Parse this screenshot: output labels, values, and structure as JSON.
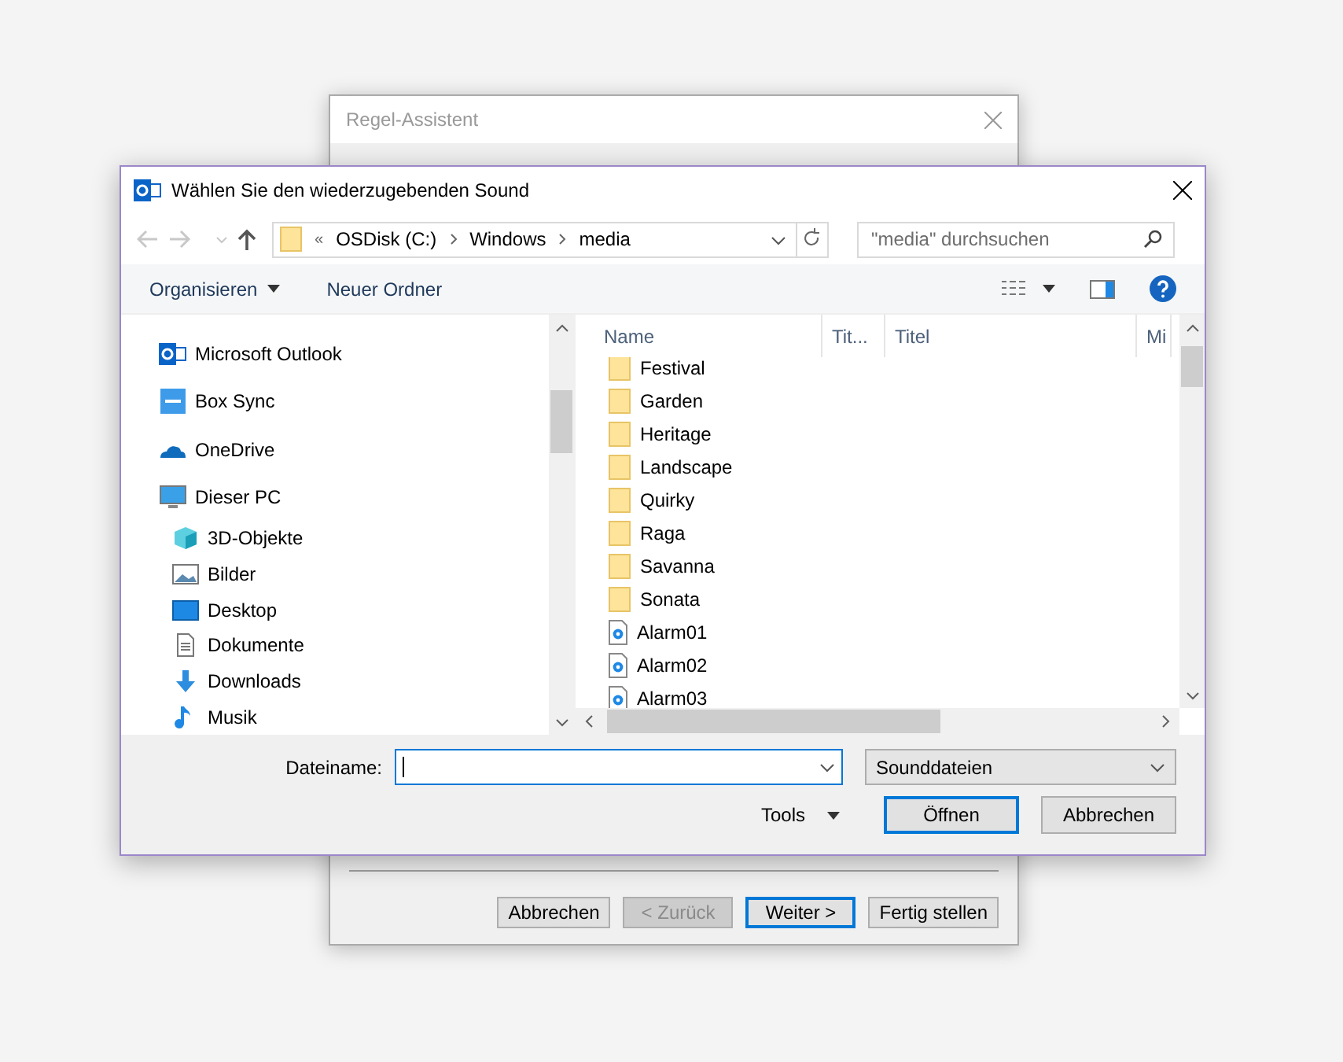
{
  "back_window": {
    "title": "Regel-Assistent",
    "buttons": [
      {
        "label": "Abbrechen",
        "disabled": false,
        "default": false
      },
      {
        "label": "< Zurück",
        "disabled": true,
        "default": false
      },
      {
        "label": "Weiter >",
        "disabled": false,
        "default": true
      },
      {
        "label": "Fertig stellen",
        "disabled": false,
        "default": false
      }
    ]
  },
  "dialog": {
    "title": "Wählen Sie den wiederzugebenden Sound",
    "breadcrumb": {
      "overflow": "«",
      "parts": [
        "OSDisk (C:)",
        "Windows",
        "media"
      ]
    },
    "search": {
      "placeholder": "\"media\" durchsuchen"
    },
    "toolbar": [
      "Organisieren",
      "Neuer Ordner"
    ],
    "tree": [
      {
        "label": "Microsoft Outlook",
        "kind": "outlook"
      },
      {
        "label": "Box Sync",
        "kind": "box"
      },
      {
        "label": "OneDrive",
        "kind": "cloud"
      },
      {
        "label": "Dieser PC",
        "kind": "pc",
        "children": [
          {
            "label": "3D-Objekte",
            "kind": "cube"
          },
          {
            "label": "Bilder",
            "kind": "pictures"
          },
          {
            "label": "Desktop",
            "kind": "desktop"
          },
          {
            "label": "Dokumente",
            "kind": "document"
          },
          {
            "label": "Downloads",
            "kind": "download"
          },
          {
            "label": "Musik",
            "kind": "music"
          }
        ]
      }
    ],
    "columns": [
      "Name",
      "Tit...",
      "Titel",
      "Mi"
    ],
    "files": [
      {
        "name": "Festival",
        "kind": "folder"
      },
      {
        "name": "Garden",
        "kind": "folder"
      },
      {
        "name": "Heritage",
        "kind": "folder"
      },
      {
        "name": "Landscape",
        "kind": "folder"
      },
      {
        "name": "Quirky",
        "kind": "folder"
      },
      {
        "name": "Raga",
        "kind": "folder"
      },
      {
        "name": "Savanna",
        "kind": "folder"
      },
      {
        "name": "Sonata",
        "kind": "folder"
      },
      {
        "name": "Alarm01",
        "kind": "audio"
      },
      {
        "name": "Alarm02",
        "kind": "audio"
      },
      {
        "name": "Alarm03",
        "kind": "audio"
      }
    ],
    "filename_label": "Dateiname:",
    "filetype": "Sounddateien",
    "tools": "Tools",
    "buttons": [
      {
        "label": "Öffnen",
        "default": true
      },
      {
        "label": "Abbrechen",
        "default": false
      }
    ]
  }
}
